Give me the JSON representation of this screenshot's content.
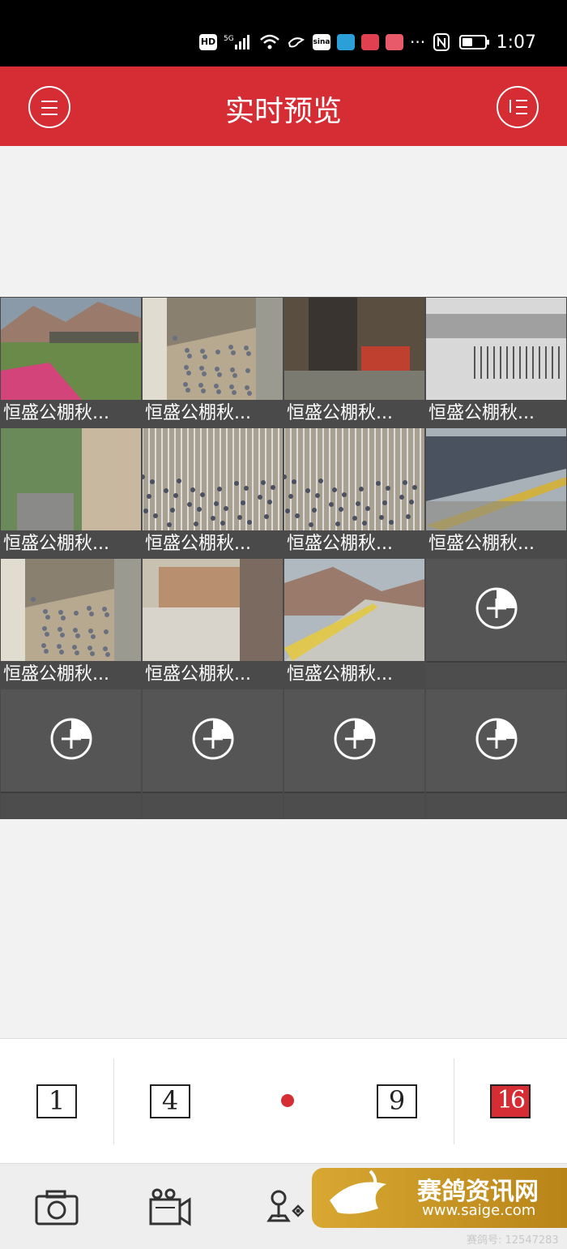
{
  "status_bar": {
    "time": "1:07",
    "indicators": [
      "HD",
      "5G",
      "signal",
      "wifi",
      "app",
      "sina",
      "app",
      "app",
      "app",
      "more",
      "nfc",
      "battery"
    ]
  },
  "header": {
    "title": "实时预览",
    "background": "#d62c33"
  },
  "cameras": [
    {
      "caption": "恒盛公棚秋...",
      "scene": "hillside",
      "selected": true
    },
    {
      "caption": "恒盛公棚秋...",
      "scene": "loft-floor"
    },
    {
      "caption": "恒盛公棚秋...",
      "scene": "interior-door"
    },
    {
      "caption": "恒盛公棚秋...",
      "scene": "gate"
    },
    {
      "caption": "恒盛公棚秋...",
      "scene": "trees-wall"
    },
    {
      "caption": "恒盛公棚秋...",
      "scene": "cage"
    },
    {
      "caption": "恒盛公棚秋...",
      "scene": "cage"
    },
    {
      "caption": "恒盛公棚秋...",
      "scene": "roof"
    },
    {
      "caption": "恒盛公棚秋...",
      "scene": "loft-floor"
    },
    {
      "caption": "恒盛公棚秋...",
      "scene": "building"
    },
    {
      "caption": "恒盛公棚秋...",
      "scene": "rooftop-hill"
    }
  ],
  "empty_slots": 5,
  "layout_modes": [
    {
      "label": "1",
      "active": false
    },
    {
      "label": "4",
      "active": false
    },
    {
      "label": "9",
      "active": false
    },
    {
      "label": "16",
      "active": true
    }
  ],
  "toolbar": [
    "camera-icon",
    "record-icon",
    "ptz-icon"
  ],
  "watermark": {
    "title": "赛鸽资讯网",
    "url": "www.saige.com",
    "id": "赛鸽号: 12547283"
  }
}
